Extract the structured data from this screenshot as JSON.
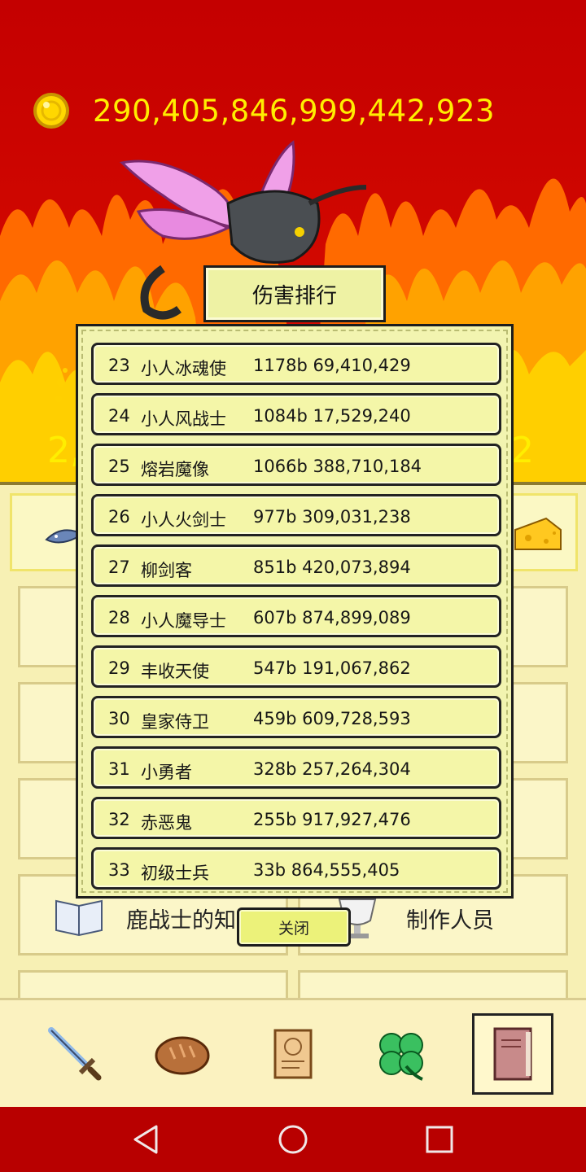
{
  "currency": {
    "amount": "290,405,846,999,442,923",
    "icon": "gold-coin-icon"
  },
  "stats": {
    "left_partial": "2,",
    "right_partial": "2"
  },
  "menu": {
    "top_item_icon": "fish-icon",
    "top_item_right_icon": "cheese-icon",
    "deer_knowledge": "鹿战士的知",
    "credits": "制作人员"
  },
  "dialog": {
    "title": "伤害排行",
    "close_label": "关闭",
    "rows": [
      {
        "rank": "23",
        "name": "小人冰魂使",
        "damage": "1178b 69,410,429"
      },
      {
        "rank": "24",
        "name": "小人风战士",
        "damage": "1084b 17,529,240"
      },
      {
        "rank": "25",
        "name": "熔岩魔像",
        "damage": "1066b 388,710,184"
      },
      {
        "rank": "26",
        "name": "小人火剑士",
        "damage": "977b 309,031,238"
      },
      {
        "rank": "27",
        "name": "柳剑客",
        "damage": "851b 420,073,894"
      },
      {
        "rank": "28",
        "name": "小人魔导士",
        "damage": "607b 874,899,089"
      },
      {
        "rank": "29",
        "name": "丰收天使",
        "damage": "547b 191,067,862"
      },
      {
        "rank": "30",
        "name": "皇家侍卫",
        "damage": "459b 609,728,593"
      },
      {
        "rank": "31",
        "name": "小勇者",
        "damage": "328b 257,264,304"
      },
      {
        "rank": "32",
        "name": "赤恶鬼",
        "damage": "255b 917,927,476"
      },
      {
        "rank": "33",
        "name": "初级士兵",
        "damage": "33b 864,555,405"
      }
    ]
  },
  "bottom_nav": [
    "sword-icon",
    "bread-icon",
    "scroll-icon",
    "clover-icon",
    "book-icon"
  ],
  "system_nav": [
    "back-icon",
    "home-icon",
    "recents-icon"
  ],
  "colors": {
    "currency_text": "#ffee00",
    "dialog_bg": "#f2f4b0",
    "row_bg": "#f4f6a8",
    "sky_red": "#c80000"
  }
}
